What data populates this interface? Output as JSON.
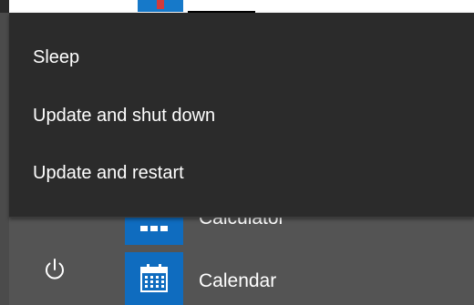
{
  "power_menu": {
    "items": [
      {
        "label": "Sleep"
      },
      {
        "label": "Update and shut down"
      },
      {
        "label": "Update and restart"
      }
    ]
  },
  "apps": [
    {
      "label": "Calculator",
      "icon": "calculator-icon"
    },
    {
      "label": "Calendar",
      "icon": "calendar-icon"
    }
  ],
  "power_button": {
    "icon": "power-icon"
  },
  "colors": {
    "menu_bg": "#2b2b2b",
    "background": "#545454",
    "tile_accent": "#0f6cbf",
    "text": "#ffffff"
  }
}
